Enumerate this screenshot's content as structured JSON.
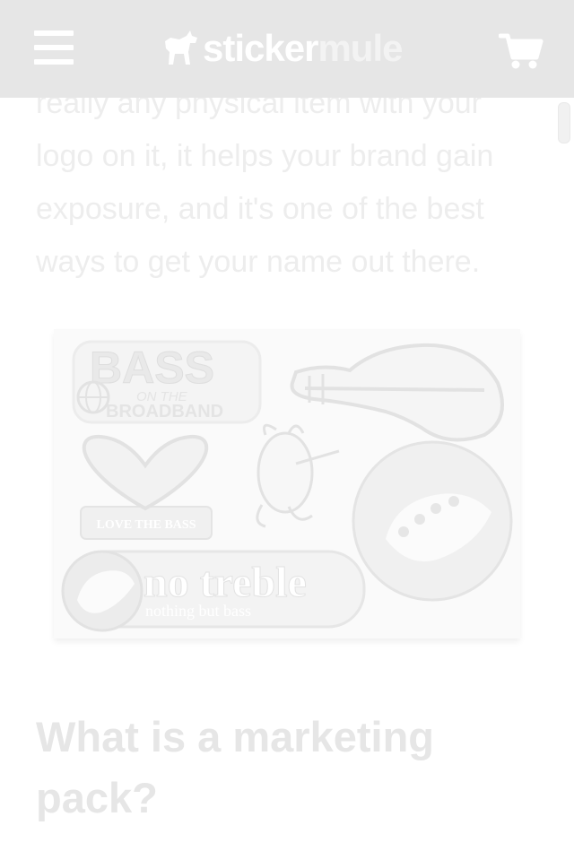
{
  "header": {
    "menu_icon": "hamburger-menu-icon",
    "logo": {
      "icon": "mule-icon",
      "word1": "sticker",
      "word2": "mule"
    },
    "cart_icon": "shopping-cart-icon"
  },
  "article": {
    "paragraph": "really any physical item with your logo on it, it helps your brand gain exposure, and it's one of the best ways to get your name out there.",
    "image": {
      "stickers": {
        "bass_title": "BASS",
        "bass_on_the": "ON THE",
        "bass_broadband": "BROADBAND",
        "heart_label": "LOVE THE BASS",
        "no_treble": "no treble",
        "no_treble_sub": "nothing but bass"
      }
    },
    "heading": "What is a marketing pack?"
  },
  "colors": {
    "header_bg": "#e6e6e6",
    "text_faded": "#ededed",
    "heading_faded": "#e6e6e6",
    "sticker_stroke": "#e2e2e2"
  }
}
